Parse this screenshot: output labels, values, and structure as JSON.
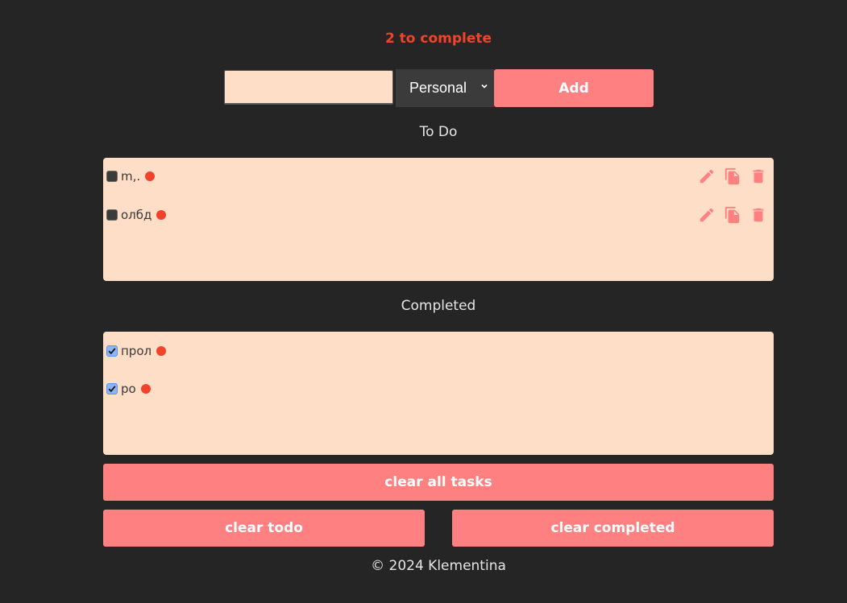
{
  "header": {
    "counter_text": "2 to complete"
  },
  "form": {
    "input_value": "",
    "input_placeholder": "",
    "category_selected": "Personal",
    "add_label": "Add"
  },
  "todo_section": {
    "title": "To Do",
    "tasks": [
      {
        "text": "m,.",
        "completed": false
      },
      {
        "text": "олбд",
        "completed": false
      }
    ]
  },
  "completed_section": {
    "title": "Completed",
    "tasks": [
      {
        "text": "прол",
        "completed": true
      },
      {
        "text": "ро",
        "completed": true
      }
    ]
  },
  "buttons": {
    "clear_all": "clear all tasks",
    "clear_todo": "clear todo",
    "clear_completed": "clear completed"
  },
  "footer": {
    "text": "© 2024 Klementina"
  },
  "colors": {
    "background": "#252525",
    "panel": "#ffdec7",
    "accent": "#ff8080",
    "priority_dot": "#f0432a"
  },
  "icons": {
    "edit": "pencil-icon",
    "copy": "copy-icon",
    "delete": "trash-icon"
  }
}
